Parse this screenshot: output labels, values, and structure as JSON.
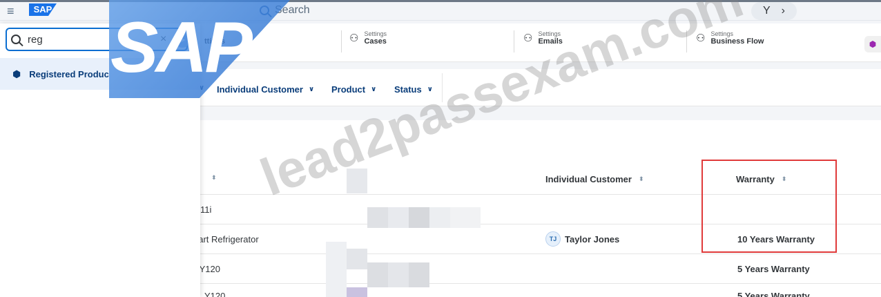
{
  "shell": {
    "menu_icon": "hamburger-icon",
    "logo_text": "SAP",
    "search_label": "Search",
    "filter_glyph": "Y",
    "forward_glyph": "›"
  },
  "tabs": [
    {
      "small": "",
      "label": "ttings"
    },
    {
      "small": "Settings",
      "label": "Cases"
    },
    {
      "small": "Settings",
      "label": "Emails"
    },
    {
      "small": "Settings",
      "label": "Business Flow"
    }
  ],
  "filters": [
    {
      "label": "Individual Customer"
    },
    {
      "label": "Product"
    },
    {
      "label": "Status"
    }
  ],
  "search_panel": {
    "query": "reg",
    "clear_glyph": "×",
    "result_label": "Registered Produc"
  },
  "table": {
    "columns": [
      {
        "label": ""
      },
      {
        "label": "Individual Customer"
      },
      {
        "label": "Warranty"
      }
    ],
    "rows": [
      {
        "product": "11i",
        "customer_initials": "",
        "customer": "",
        "warranty": ""
      },
      {
        "product": "nart Refrigerator",
        "customer_initials": "TJ",
        "customer": "Taylor Jones",
        "warranty": "10 Years Warranty"
      },
      {
        "product": "e Y120",
        "customer_initials": "",
        "customer": "",
        "warranty": "5 Years Warranty"
      },
      {
        "product": "Y120",
        "customer_initials": "",
        "customer": "",
        "warranty": "5 Years Warranty"
      }
    ]
  },
  "overlay": {
    "sap_logo": "SAP",
    "watermark": "lead2passexam.com"
  },
  "colors": {
    "accent": "#0a6ed1",
    "link": "#0a3d7a",
    "highlight": "#e03a3a"
  }
}
